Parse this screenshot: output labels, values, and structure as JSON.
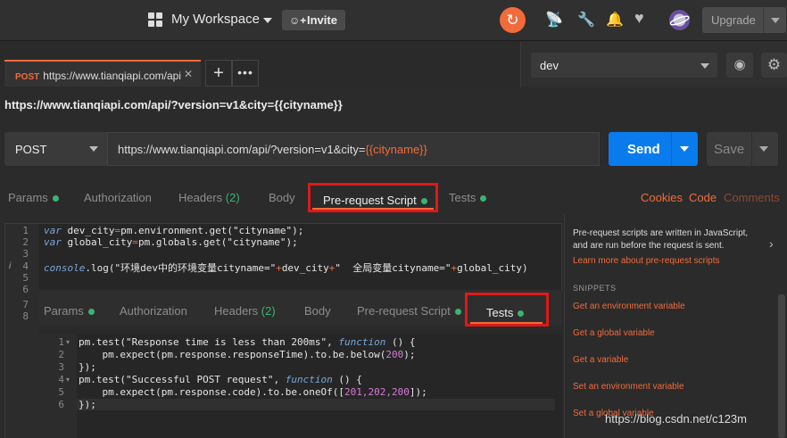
{
  "topbar": {
    "workspace_label": "My Workspace",
    "invite_label": "Invite",
    "upgrade_label": "Upgrade"
  },
  "tabs": {
    "active": {
      "method": "POST",
      "url": "https://www.tianqiapi.com/api"
    }
  },
  "environment": {
    "selected": "dev"
  },
  "request": {
    "title": "https://www.tianqiapi.com/api/?version=v1&city={{cityname}}",
    "method": "POST",
    "url_prefix": "https://www.tianqiapi.com/api/?version=v1&city=",
    "url_variable": "{{cityname}}",
    "send_label": "Send",
    "save_label": "Save"
  },
  "subtabs": {
    "params": "Params",
    "authorization": "Authorization",
    "headers": "Headers",
    "headers_count": "(2)",
    "body": "Body",
    "prerequest": "Pre-request Script",
    "tests": "Tests",
    "cookies": "Cookies",
    "code": "Code",
    "comments": "Comments"
  },
  "editor": {
    "line_numbers": [
      "1",
      "2",
      "3",
      "4",
      "5",
      "6",
      "7",
      "8"
    ],
    "lines": {
      "l1_kw": "var",
      "l1_a": " dev_city",
      "l1_op": "=",
      "l1_b": "pm.environment.get(\"cityname\");",
      "l2_kw": "var",
      "l2_a": " global_city",
      "l2_op": "=",
      "l2_b": "pm.globals.get(\"cityname\");",
      "l4_kw": "console",
      "l4_a": ".log(\"环境dev中的环境变量cityname=\"",
      "l4_op1": "+",
      "l4_b": "dev_city",
      "l4_op2": "+",
      "l4_c": "\"  全局变量cityname=\"",
      "l4_op3": "+",
      "l4_d": "global_city)"
    }
  },
  "inner": {
    "tabs": {
      "params": "Params",
      "authorization": "Authorization",
      "headers": "Headers",
      "headers_count": "(2)",
      "body": "Body",
      "prerequest": "Pre-request Script",
      "tests": "Tests"
    },
    "line_numbers": [
      "1",
      "2",
      "3",
      "4",
      "5",
      "6"
    ],
    "code": {
      "c1a": "pm.test(\"Response time is less than 200ms\", ",
      "c1kw": "function",
      "c1b": " () {",
      "c2a": "    pm.expect(pm.response.responseTime).to.be.below(",
      "c2n": "200",
      "c2b": ");",
      "c3": "});",
      "c4a": "pm.test(\"Successful POST request\", ",
      "c4kw": "function",
      "c4b": " () {",
      "c5a": "    pm.expect(pm.response.code).to.be.oneOf([",
      "c5n": "201,202,200",
      "c5b": "]);",
      "c6": "});"
    }
  },
  "right_panel": {
    "description": "Pre-request scripts are written in JavaScript, and are run before the request is sent.",
    "learn_more": "Learn more about pre-request scripts",
    "snippets_heading": "SNIPPETS",
    "snippets": [
      "Get an environment variable",
      "Get a global variable",
      "Get a variable",
      "Set an environment variable",
      "Set a global variable"
    ]
  },
  "watermark": "https://blog.csdn.net/c123m",
  "colors": {
    "accent": "#f26b3a",
    "send": "#097bed",
    "highlight_box": "#e01818",
    "dot": "#3cb371"
  }
}
